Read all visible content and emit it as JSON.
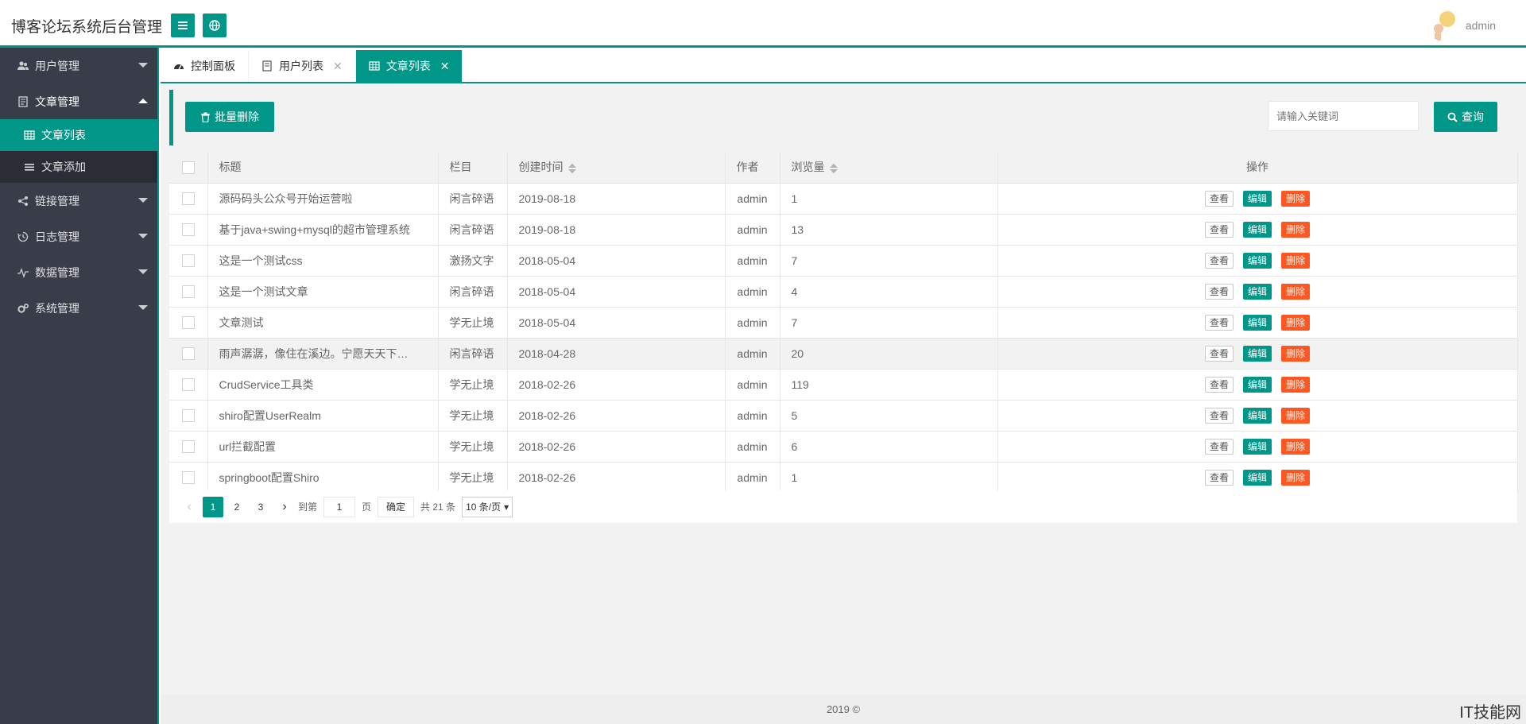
{
  "header": {
    "title": "博客论坛系统后台管理",
    "username": "admin"
  },
  "sidebar": {
    "items": [
      {
        "label": "用户管理",
        "icon": "users-icon"
      },
      {
        "label": "文章管理",
        "icon": "article-icon",
        "open": true,
        "sub": [
          {
            "label": "文章列表",
            "icon": "table-icon",
            "active": true
          },
          {
            "label": "文章添加",
            "icon": "list-icon"
          }
        ]
      },
      {
        "label": "链接管理",
        "icon": "share-icon"
      },
      {
        "label": "日志管理",
        "icon": "log-icon"
      },
      {
        "label": "数据管理",
        "icon": "chart-icon"
      },
      {
        "label": "系统管理",
        "icon": "gears-icon"
      }
    ]
  },
  "tabs": [
    {
      "label": "控制面板",
      "closable": false
    },
    {
      "label": "用户列表",
      "closable": true
    },
    {
      "label": "文章列表",
      "closable": true,
      "active": true
    }
  ],
  "toolbar": {
    "batch_delete": "批量删除",
    "search_placeholder": "请输入关键词",
    "search_button": "查询"
  },
  "table": {
    "headers": {
      "title": "标题",
      "column": "栏目",
      "created": "创建时间",
      "author": "作者",
      "views": "浏览量",
      "actions": "操作"
    },
    "action_labels": {
      "view": "查看",
      "edit": "编辑",
      "delete": "删除"
    },
    "rows": [
      {
        "title": "源码码头公众号开始运营啦",
        "column": "闲言碎语",
        "created": "2019-08-18",
        "author": "admin",
        "views": "1"
      },
      {
        "title": "基于java+swing+mysql的超市管理系统",
        "column": "闲言碎语",
        "created": "2019-08-18",
        "author": "admin",
        "views": "13"
      },
      {
        "title": "这是一个测试css",
        "column": "激扬文字",
        "created": "2018-05-04",
        "author": "admin",
        "views": "7"
      },
      {
        "title": "这是一个测试文章",
        "column": "闲言碎语",
        "created": "2018-05-04",
        "author": "admin",
        "views": "4"
      },
      {
        "title": "文章测试",
        "column": "学无止境",
        "created": "2018-05-04",
        "author": "admin",
        "views": "7"
      },
      {
        "title": "雨声潺潺，像住在溪边。宁愿天天下…",
        "column": "闲言碎语",
        "created": "2018-04-28",
        "author": "admin",
        "views": "20",
        "hover": true
      },
      {
        "title": "CrudService工具类",
        "column": "学无止境",
        "created": "2018-02-26",
        "author": "admin",
        "views": "119"
      },
      {
        "title": "shiro配置UserRealm",
        "column": "学无止境",
        "created": "2018-02-26",
        "author": "admin",
        "views": "5"
      },
      {
        "title": "url拦截配置",
        "column": "学无止境",
        "created": "2018-02-26",
        "author": "admin",
        "views": "6"
      },
      {
        "title": "springboot配置Shiro",
        "column": "学无止境",
        "created": "2018-02-26",
        "author": "admin",
        "views": "1"
      }
    ]
  },
  "pagination": {
    "pages": [
      "1",
      "2",
      "3"
    ],
    "current": "1",
    "goto_label": "到第",
    "goto_value": "1",
    "page_unit": "页",
    "confirm": "确定",
    "total": "共 21 条",
    "page_size": "10 条/页"
  },
  "footer": {
    "text": "2019 ©"
  },
  "watermark": "IT技能网",
  "colors": {
    "accent": "#009688",
    "danger": "#ff5722",
    "sidebar": "#393d49"
  }
}
